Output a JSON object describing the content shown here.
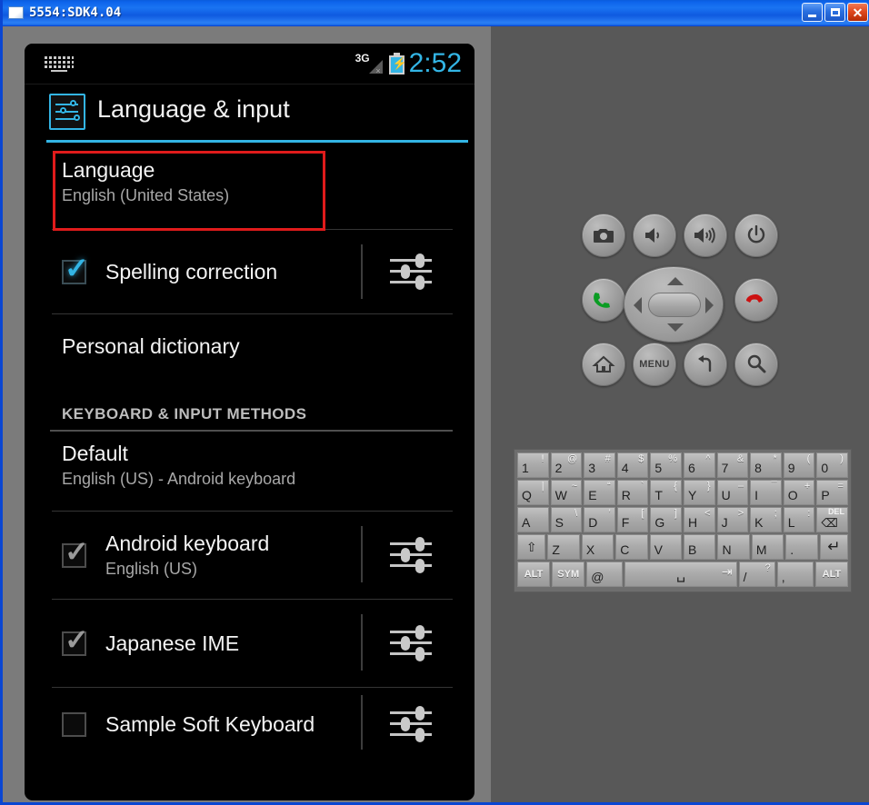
{
  "window": {
    "title": "5554:SDK4.04",
    "buttons": {
      "minimize": "_",
      "maximize": "□",
      "close": "✕"
    }
  },
  "phone": {
    "statusbar": {
      "keyboard_icon": "keyboard-icon",
      "network": "3G",
      "network_x": "×",
      "battery_icon": "battery-charging-icon",
      "battery_bolt": "⚡",
      "time": "2:52"
    },
    "header": {
      "icon": "language-input-settings-icon",
      "title": "Language & input"
    },
    "rows": [
      {
        "title": "Language",
        "subtitle": "English (United States)",
        "highlighted": true
      },
      {
        "title": "Spelling correction",
        "checkbox": "checked-blue",
        "settings": true
      },
      {
        "title": "Personal dictionary"
      }
    ],
    "section_header": "KEYBOARD & INPUT METHODS",
    "keyboard_rows": [
      {
        "title": "Default",
        "subtitle": "English (US) - Android keyboard"
      },
      {
        "title": "Android keyboard",
        "subtitle": "English (US)",
        "checkbox": "checked",
        "settings": true
      },
      {
        "title": "Japanese IME",
        "checkbox": "checked",
        "settings": true
      },
      {
        "title": "Sample Soft Keyboard",
        "checkbox": "unchecked",
        "settings": true
      }
    ]
  },
  "emulator": {
    "controls": [
      {
        "name": "camera-button",
        "label": "camera-icon"
      },
      {
        "name": "volume-down-button",
        "label": "volume-down-icon"
      },
      {
        "name": "volume-up-button",
        "label": "volume-up-icon"
      },
      {
        "name": "power-button",
        "label": "power-icon"
      },
      {
        "name": "call-button",
        "label": "call-green-icon"
      },
      {
        "name": "dpad",
        "label": "dpad-control"
      },
      {
        "name": "end-call-button",
        "label": "end-call-red-icon"
      },
      {
        "name": "home-button",
        "label": "home-icon"
      },
      {
        "name": "menu-button",
        "label": "MENU"
      },
      {
        "name": "back-button",
        "label": "back-icon"
      },
      {
        "name": "search-button",
        "label": "search-icon"
      }
    ],
    "menu_label": "MENU"
  },
  "keyboard": {
    "row1": [
      {
        "main": "1",
        "alt": "!"
      },
      {
        "main": "2",
        "alt": "@"
      },
      {
        "main": "3",
        "alt": "#"
      },
      {
        "main": "4",
        "alt": "$"
      },
      {
        "main": "5",
        "alt": "%"
      },
      {
        "main": "6",
        "alt": "^"
      },
      {
        "main": "7",
        "alt": "&"
      },
      {
        "main": "8",
        "alt": "*"
      },
      {
        "main": "9",
        "alt": "("
      },
      {
        "main": "0",
        "alt": ")"
      }
    ],
    "row2": [
      {
        "main": "Q",
        "alt": "|"
      },
      {
        "main": "W",
        "alt": "~"
      },
      {
        "main": "E",
        "alt": "“"
      },
      {
        "main": "R",
        "alt": "`"
      },
      {
        "main": "T",
        "alt": "{"
      },
      {
        "main": "Y",
        "alt": "}"
      },
      {
        "main": "U",
        "alt": "–"
      },
      {
        "main": "I",
        "alt": "¯"
      },
      {
        "main": "O",
        "alt": "+"
      },
      {
        "main": "P",
        "alt": "="
      }
    ],
    "row3": [
      {
        "main": "A",
        "alt": ""
      },
      {
        "main": "S",
        "alt": "\\"
      },
      {
        "main": "D",
        "alt": "’"
      },
      {
        "main": "F",
        "alt": "["
      },
      {
        "main": "G",
        "alt": "]"
      },
      {
        "main": "H",
        "alt": "<"
      },
      {
        "main": "J",
        "alt": ">"
      },
      {
        "main": "K",
        "alt": ";"
      },
      {
        "main": "L",
        "alt": ":"
      },
      {
        "main": "DEL",
        "alt": "⌫"
      }
    ],
    "row4": [
      {
        "main": "⇧",
        "alt": ""
      },
      {
        "main": "Z",
        "alt": ""
      },
      {
        "main": "X",
        "alt": ""
      },
      {
        "main": "C",
        "alt": ""
      },
      {
        "main": "V",
        "alt": ""
      },
      {
        "main": "B",
        "alt": ""
      },
      {
        "main": "N",
        "alt": ""
      },
      {
        "main": "M",
        "alt": ""
      },
      {
        "main": ".",
        "alt": ""
      },
      {
        "main": "↵",
        "alt": ""
      }
    ],
    "row5": [
      {
        "main": "ALT",
        "alt": ""
      },
      {
        "main": "SYM",
        "alt": ""
      },
      {
        "main": "@",
        "alt": ""
      },
      {
        "main": "␣",
        "alt": "⇥"
      },
      {
        "main": "/",
        "alt": "?"
      },
      {
        "main": ",",
        "alt": ""
      },
      {
        "main": "ALT",
        "alt": ""
      }
    ]
  },
  "colors": {
    "accent_blue": "#33b5e5",
    "highlight_red": "#e01b1b",
    "titlebar_blue": "#1a74f2"
  }
}
